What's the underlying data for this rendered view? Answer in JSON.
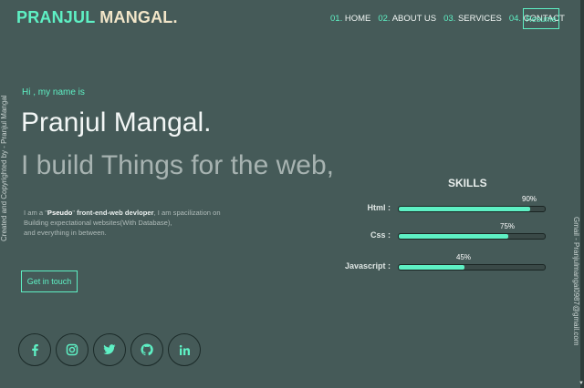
{
  "logo": {
    "first": "PRANJUL",
    "last": "MANGAL."
  },
  "nav": [
    {
      "num": "01.",
      "label": "HOME"
    },
    {
      "num": "02.",
      "label": "ABOUT US"
    },
    {
      "num": "03.",
      "label": "SERVICES"
    },
    {
      "num": "04.",
      "label": "CONTACT"
    }
  ],
  "resume_label": "Resume",
  "side_left": "Created and Copyrighted by - Pranjul Mangal",
  "side_right": "Gmail - Pranjulmangal0987@gmail.com",
  "hero": {
    "greeting": "Hi , my name is",
    "name": "Pranjul Mangal.",
    "tagline": "I build Things for the web,"
  },
  "bio": {
    "prefix": "I am a \"",
    "highlight": "Pseudo",
    "middle": "\" ",
    "role": "front-end-web devloper",
    "rest1": ", I am spacilization on",
    "line2": "Building expectational websites(With Database),",
    "line3": "and everything in between."
  },
  "cta_label": "Get in touch",
  "socials": [
    {
      "icon": "facebook-icon",
      "glyph": "f"
    },
    {
      "icon": "instagram-icon",
      "glyph": "◎"
    },
    {
      "icon": "twitter-icon",
      "glyph": "t"
    },
    {
      "icon": "github-icon",
      "glyph": "⌬"
    },
    {
      "icon": "linkedin-icon",
      "glyph": "in"
    }
  ],
  "skills": {
    "title": "SKILLS",
    "items": [
      {
        "name": "Html :",
        "percent": 90,
        "label": "90%"
      },
      {
        "name": "Css :",
        "percent": 75,
        "label": "75%"
      },
      {
        "name": "Javascript :",
        "percent": 45,
        "label": "45%"
      }
    ]
  },
  "colors": {
    "background": "#455a58",
    "accent": "#5ef0c4",
    "logo_last": "#f2e6c9"
  }
}
